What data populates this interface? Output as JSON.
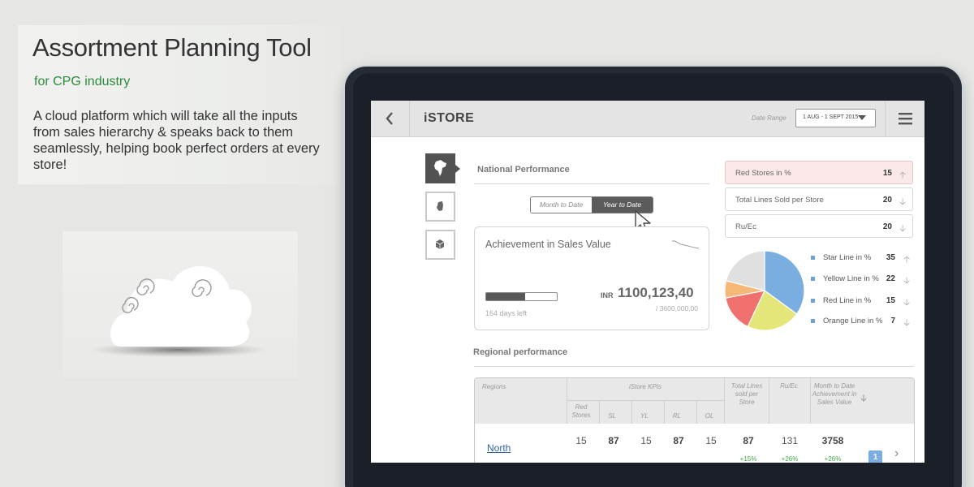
{
  "promo": {
    "title": "Assortment Planning Tool",
    "subtitle": "for CPG industry",
    "description": "A cloud platform which will take all the inputs from sales hierarchy & speaks back to them seamlessly, helping book perfect orders at every store!"
  },
  "app": {
    "title": "iSTORE",
    "date_range_label": "Date Range",
    "date_range_value": "1 AUG - 1 SEPT 2015"
  },
  "national": {
    "title": "National Performance",
    "toggle": [
      "Month to Date",
      "Year to Date"
    ],
    "active_toggle": 1,
    "card": {
      "title": "Achievement in Sales Value",
      "progress": 0.55,
      "days_left": "164 days left",
      "currency": "INR",
      "value": "1100,123,40",
      "target": "/ 3600,000,00"
    }
  },
  "kpis": [
    {
      "label": "Red Stores in %",
      "value": "15",
      "dir": "up",
      "highlight": true
    },
    {
      "label": "Total Lines Sold per Store",
      "value": "20",
      "dir": "down",
      "highlight": false
    },
    {
      "label": "Ru/Ec",
      "value": "20",
      "dir": "down",
      "highlight": false
    }
  ],
  "lines": [
    {
      "label": "Star Line in %",
      "value": "35",
      "dir": "up",
      "color": "#7aaee0"
    },
    {
      "label": "Yellow Line in %",
      "value": "22",
      "dir": "down",
      "color": "#e4e67a"
    },
    {
      "label": "Red Line in %",
      "value": "15",
      "dir": "down",
      "color": "#f0706e"
    },
    {
      "label": "Orange Line in %",
      "value": "7",
      "dir": "down",
      "color": "#f6b879"
    }
  ],
  "pie_colors": {
    "grey": "#e0e0e0",
    "legend_square": "#6fa3d2"
  },
  "regional": {
    "title": "Regional performance",
    "headers": {
      "regions": "Regions",
      "kpis": "iStore KPIs",
      "sub": [
        "Red Stores",
        "SL",
        "YL",
        "RL",
        "OL"
      ],
      "total_lines": "Total Lines sold per Store",
      "ru_ec": "Ru/Ec",
      "mtd": "Month to Date Achievement in Sales Value"
    },
    "row": {
      "region": "North",
      "values": [
        "15",
        "87",
        "15",
        "87",
        "15"
      ],
      "total_lines": "87",
      "total_lines_delta": "+15%",
      "ru_ec": "131",
      "ru_ec_delta": "+26%",
      "mtd": "3758",
      "mtd_delta": "+26%"
    },
    "page": "1"
  },
  "colors": {
    "accent_green": "#2c8a3c",
    "link_blue": "#2f64a8",
    "delta_green": "#3fa547"
  }
}
